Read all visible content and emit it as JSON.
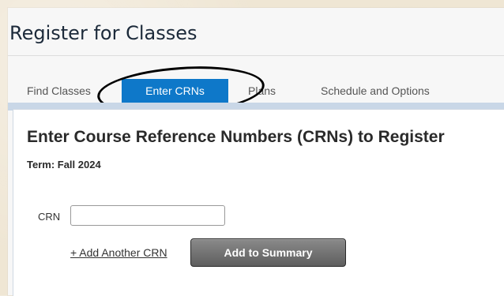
{
  "header": {
    "title": "Register for Classes"
  },
  "tabs": [
    {
      "label": "Find Classes",
      "active": false
    },
    {
      "label": "Enter CRNs",
      "active": true
    },
    {
      "label": "Plans",
      "active": false
    },
    {
      "label": "Schedule and Options",
      "active": false
    }
  ],
  "panel": {
    "heading": "Enter Course Reference Numbers (CRNs) to Register",
    "term": "Term: Fall 2024",
    "crn_label": "CRN",
    "crn_value": "",
    "add_crn_link": "+ Add Another CRN",
    "add_summary_button": "Add to Summary"
  },
  "colors": {
    "active_tab": "#0e78c9",
    "button": "#6f6f6f",
    "highlight_circle": "#000000"
  }
}
